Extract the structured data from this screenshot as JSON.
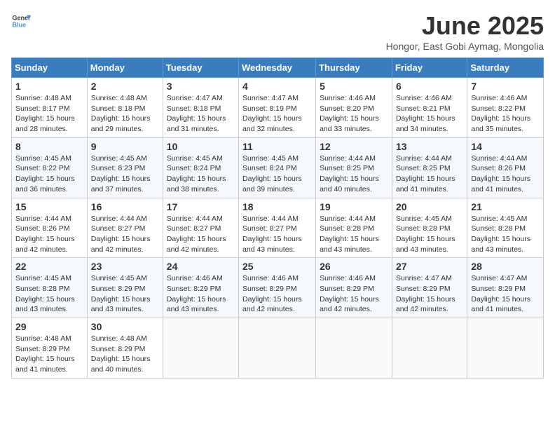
{
  "header": {
    "logo_general": "General",
    "logo_blue": "Blue",
    "month_title": "June 2025",
    "location": "Hongor, East Gobi Aymag, Mongolia"
  },
  "weekdays": [
    "Sunday",
    "Monday",
    "Tuesday",
    "Wednesday",
    "Thursday",
    "Friday",
    "Saturday"
  ],
  "weeks": [
    [
      {
        "day": "1",
        "sunrise": "Sunrise: 4:48 AM",
        "sunset": "Sunset: 8:17 PM",
        "daylight": "Daylight: 15 hours and 28 minutes."
      },
      {
        "day": "2",
        "sunrise": "Sunrise: 4:48 AM",
        "sunset": "Sunset: 8:18 PM",
        "daylight": "Daylight: 15 hours and 29 minutes."
      },
      {
        "day": "3",
        "sunrise": "Sunrise: 4:47 AM",
        "sunset": "Sunset: 8:18 PM",
        "daylight": "Daylight: 15 hours and 31 minutes."
      },
      {
        "day": "4",
        "sunrise": "Sunrise: 4:47 AM",
        "sunset": "Sunset: 8:19 PM",
        "daylight": "Daylight: 15 hours and 32 minutes."
      },
      {
        "day": "5",
        "sunrise": "Sunrise: 4:46 AM",
        "sunset": "Sunset: 8:20 PM",
        "daylight": "Daylight: 15 hours and 33 minutes."
      },
      {
        "day": "6",
        "sunrise": "Sunrise: 4:46 AM",
        "sunset": "Sunset: 8:21 PM",
        "daylight": "Daylight: 15 hours and 34 minutes."
      },
      {
        "day": "7",
        "sunrise": "Sunrise: 4:46 AM",
        "sunset": "Sunset: 8:22 PM",
        "daylight": "Daylight: 15 hours and 35 minutes."
      }
    ],
    [
      {
        "day": "8",
        "sunrise": "Sunrise: 4:45 AM",
        "sunset": "Sunset: 8:22 PM",
        "daylight": "Daylight: 15 hours and 36 minutes."
      },
      {
        "day": "9",
        "sunrise": "Sunrise: 4:45 AM",
        "sunset": "Sunset: 8:23 PM",
        "daylight": "Daylight: 15 hours and 37 minutes."
      },
      {
        "day": "10",
        "sunrise": "Sunrise: 4:45 AM",
        "sunset": "Sunset: 8:24 PM",
        "daylight": "Daylight: 15 hours and 38 minutes."
      },
      {
        "day": "11",
        "sunrise": "Sunrise: 4:45 AM",
        "sunset": "Sunset: 8:24 PM",
        "daylight": "Daylight: 15 hours and 39 minutes."
      },
      {
        "day": "12",
        "sunrise": "Sunrise: 4:44 AM",
        "sunset": "Sunset: 8:25 PM",
        "daylight": "Daylight: 15 hours and 40 minutes."
      },
      {
        "day": "13",
        "sunrise": "Sunrise: 4:44 AM",
        "sunset": "Sunset: 8:25 PM",
        "daylight": "Daylight: 15 hours and 41 minutes."
      },
      {
        "day": "14",
        "sunrise": "Sunrise: 4:44 AM",
        "sunset": "Sunset: 8:26 PM",
        "daylight": "Daylight: 15 hours and 41 minutes."
      }
    ],
    [
      {
        "day": "15",
        "sunrise": "Sunrise: 4:44 AM",
        "sunset": "Sunset: 8:26 PM",
        "daylight": "Daylight: 15 hours and 42 minutes."
      },
      {
        "day": "16",
        "sunrise": "Sunrise: 4:44 AM",
        "sunset": "Sunset: 8:27 PM",
        "daylight": "Daylight: 15 hours and 42 minutes."
      },
      {
        "day": "17",
        "sunrise": "Sunrise: 4:44 AM",
        "sunset": "Sunset: 8:27 PM",
        "daylight": "Daylight: 15 hours and 42 minutes."
      },
      {
        "day": "18",
        "sunrise": "Sunrise: 4:44 AM",
        "sunset": "Sunset: 8:27 PM",
        "daylight": "Daylight: 15 hours and 43 minutes."
      },
      {
        "day": "19",
        "sunrise": "Sunrise: 4:44 AM",
        "sunset": "Sunset: 8:28 PM",
        "daylight": "Daylight: 15 hours and 43 minutes."
      },
      {
        "day": "20",
        "sunrise": "Sunrise: 4:45 AM",
        "sunset": "Sunset: 8:28 PM",
        "daylight": "Daylight: 15 hours and 43 minutes."
      },
      {
        "day": "21",
        "sunrise": "Sunrise: 4:45 AM",
        "sunset": "Sunset: 8:28 PM",
        "daylight": "Daylight: 15 hours and 43 minutes."
      }
    ],
    [
      {
        "day": "22",
        "sunrise": "Sunrise: 4:45 AM",
        "sunset": "Sunset: 8:28 PM",
        "daylight": "Daylight: 15 hours and 43 minutes."
      },
      {
        "day": "23",
        "sunrise": "Sunrise: 4:45 AM",
        "sunset": "Sunset: 8:29 PM",
        "daylight": "Daylight: 15 hours and 43 minutes."
      },
      {
        "day": "24",
        "sunrise": "Sunrise: 4:46 AM",
        "sunset": "Sunset: 8:29 PM",
        "daylight": "Daylight: 15 hours and 43 minutes."
      },
      {
        "day": "25",
        "sunrise": "Sunrise: 4:46 AM",
        "sunset": "Sunset: 8:29 PM",
        "daylight": "Daylight: 15 hours and 42 minutes."
      },
      {
        "day": "26",
        "sunrise": "Sunrise: 4:46 AM",
        "sunset": "Sunset: 8:29 PM",
        "daylight": "Daylight: 15 hours and 42 minutes."
      },
      {
        "day": "27",
        "sunrise": "Sunrise: 4:47 AM",
        "sunset": "Sunset: 8:29 PM",
        "daylight": "Daylight: 15 hours and 42 minutes."
      },
      {
        "day": "28",
        "sunrise": "Sunrise: 4:47 AM",
        "sunset": "Sunset: 8:29 PM",
        "daylight": "Daylight: 15 hours and 41 minutes."
      }
    ],
    [
      {
        "day": "29",
        "sunrise": "Sunrise: 4:48 AM",
        "sunset": "Sunset: 8:29 PM",
        "daylight": "Daylight: 15 hours and 41 minutes."
      },
      {
        "day": "30",
        "sunrise": "Sunrise: 4:48 AM",
        "sunset": "Sunset: 8:29 PM",
        "daylight": "Daylight: 15 hours and 40 minutes."
      },
      null,
      null,
      null,
      null,
      null
    ]
  ]
}
